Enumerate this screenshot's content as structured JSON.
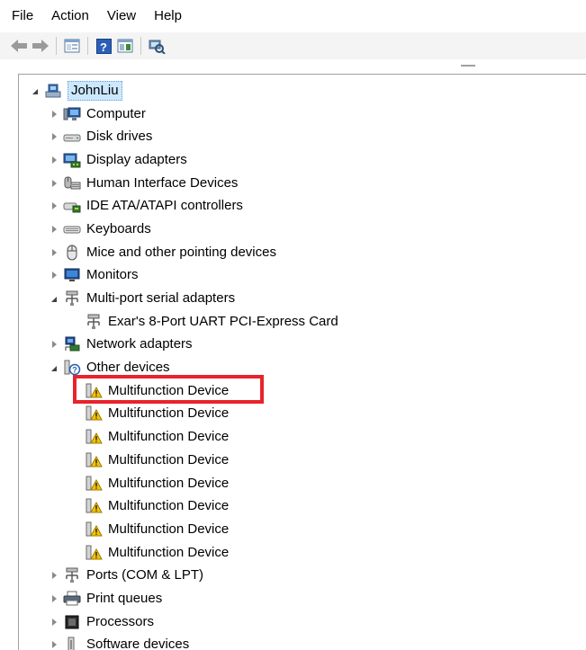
{
  "menu": {
    "file": "File",
    "action": "Action",
    "view": "View",
    "help": "Help"
  },
  "toolbar": {
    "buttons": [
      "back-arrow-icon",
      "forward-arrow-icon",
      "properties-icon",
      "help-icon",
      "console-view-icon",
      "scan-hardware-icon"
    ],
    "help_glyph": "?"
  },
  "tree": {
    "root": "JohnLiu",
    "items": [
      {
        "label": "Computer",
        "icon": "computer-icon",
        "state": "collapsed"
      },
      {
        "label": "Disk drives",
        "icon": "disk-drive-icon",
        "state": "collapsed"
      },
      {
        "label": "Display adapters",
        "icon": "display-adapter-icon",
        "state": "collapsed"
      },
      {
        "label": "Human Interface Devices",
        "icon": "hid-icon",
        "state": "collapsed"
      },
      {
        "label": "IDE ATA/ATAPI controllers",
        "icon": "ide-controller-icon",
        "state": "collapsed"
      },
      {
        "label": "Keyboards",
        "icon": "keyboard-icon",
        "state": "collapsed"
      },
      {
        "label": "Mice and other pointing devices",
        "icon": "mouse-icon",
        "state": "collapsed"
      },
      {
        "label": "Monitors",
        "icon": "monitor-icon",
        "state": "collapsed"
      },
      {
        "label": "Multi-port serial adapters",
        "icon": "serial-adapter-icon",
        "state": "expanded",
        "children": [
          {
            "label": "Exar's 8-Port UART PCI-Express Card",
            "icon": "serial-adapter-icon"
          }
        ]
      },
      {
        "label": "Network adapters",
        "icon": "network-adapter-icon",
        "state": "collapsed"
      },
      {
        "label": "Other devices",
        "icon": "unknown-device-icon",
        "state": "expanded",
        "children": [
          {
            "label": "Multifunction Device",
            "icon": "warning-device-icon"
          },
          {
            "label": "Multifunction Device",
            "icon": "warning-device-icon"
          },
          {
            "label": "Multifunction Device",
            "icon": "warning-device-icon"
          },
          {
            "label": "Multifunction Device",
            "icon": "warning-device-icon"
          },
          {
            "label": "Multifunction Device",
            "icon": "warning-device-icon"
          },
          {
            "label": "Multifunction Device",
            "icon": "warning-device-icon"
          },
          {
            "label": "Multifunction Device",
            "icon": "warning-device-icon"
          },
          {
            "label": "Multifunction Device",
            "icon": "warning-device-icon"
          }
        ]
      },
      {
        "label": "Ports (COM & LPT)",
        "icon": "port-icon",
        "state": "collapsed"
      },
      {
        "label": "Print queues",
        "icon": "printer-icon",
        "state": "collapsed"
      },
      {
        "label": "Processors",
        "icon": "processor-icon",
        "state": "collapsed"
      },
      {
        "label": "Software devices",
        "icon": "software-device-icon",
        "state": "collapsed"
      }
    ]
  },
  "colors": {
    "highlight": "#e8232a",
    "selection": "#cce8ff"
  }
}
